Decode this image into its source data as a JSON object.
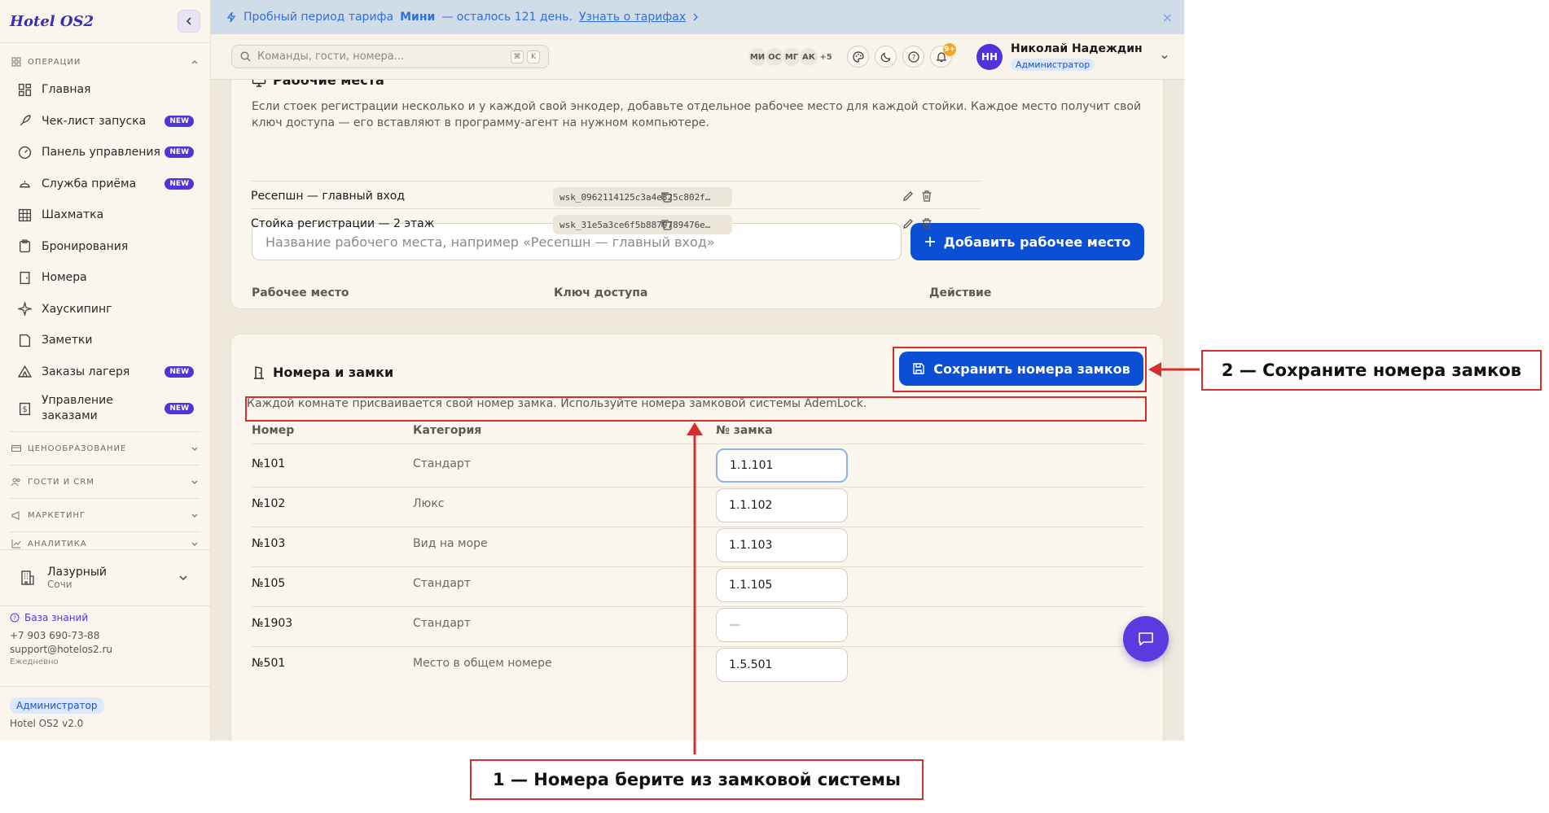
{
  "app": {
    "logo": "Hotel OS2"
  },
  "sidebar": {
    "sections": {
      "operations": "ОПЕРАЦИИ",
      "pricing": "ЦЕНООБРАЗОВАНИЕ",
      "guests": "ГОСТИ И CRM",
      "marketing": "МАРКЕТИНГ",
      "analytics": "АНАЛИТИКА"
    },
    "items": [
      {
        "label": "Главная",
        "badge": ""
      },
      {
        "label": "Чек-лист запуска",
        "badge": "NEW"
      },
      {
        "label": "Панель управления",
        "badge": "NEW"
      },
      {
        "label": "Служба приёма",
        "badge": "NEW"
      },
      {
        "label": "Шахматка",
        "badge": ""
      },
      {
        "label": "Бронирования",
        "badge": ""
      },
      {
        "label": "Номера",
        "badge": ""
      },
      {
        "label": "Хаускипинг",
        "badge": ""
      },
      {
        "label": "Заметки",
        "badge": ""
      },
      {
        "label": "Заказы лагеря",
        "badge": "NEW"
      },
      {
        "label": "Управление заказами",
        "badge": "NEW"
      }
    ],
    "hotel": {
      "name": "Лазурный",
      "city": "Сочи"
    },
    "knowledge_base": "База знаний",
    "phone": "+7 903 690-73-88",
    "email": "support@hotelos2.ru",
    "hours": "Ежедневно",
    "role": "Администратор",
    "version": "Hotel OS2 v2.0"
  },
  "banner": {
    "prefix": "Пробный период тарифа",
    "plan": "Мини",
    "suffix": "— осталось 121 день.",
    "link": "Узнать о тарифах",
    "close": "×"
  },
  "topbar": {
    "search_placeholder": "Команды, гости, номера...",
    "kbd": [
      "⌘",
      "K"
    ],
    "avatars": [
      "МИ",
      "ОС",
      "МГ",
      "АК"
    ],
    "more_avatars": "+5",
    "notif_count": "9+",
    "user": {
      "initials": "НН",
      "name": "Николай Надеждин",
      "role": "Администратор"
    }
  },
  "workplaces": {
    "title": "Рабочие места",
    "description": "Если стоек регистрации несколько и у каждой свой энкодер, добавьте отдельное рабочее место для каждой стойки. Каждое место получит свой ключ доступа — его вставляют в программу-агент на нужном компьютере.",
    "input_placeholder": "Название рабочего места, например «Ресепшн — главный вход»",
    "add_button": "Добавить рабочее место",
    "columns": {
      "place": "Рабочее место",
      "key": "Ключ доступа",
      "action": "Действие"
    },
    "rows": [
      {
        "name": "Ресепшн — главный вход",
        "key": "wsk_0962114125c3a4e325c802f…"
      },
      {
        "name": "Стойка регистрации — 2 этаж",
        "key": "wsk_31e5a3ce6f5b8879789476e…"
      }
    ]
  },
  "locks": {
    "title": "Номера и замки",
    "save_button": "Сохранить номера замков",
    "description": "Каждой комнате присваивается свой номер замка. Используйте номера замковой системы AdemLock.",
    "columns": {
      "room": "Номер",
      "category": "Категория",
      "lock": "№ замка"
    },
    "rows": [
      {
        "room": "№101",
        "category": "Стандарт",
        "lock": "1.1.101"
      },
      {
        "room": "№102",
        "category": "Люкс",
        "lock": "1.1.102"
      },
      {
        "room": "№103",
        "category": "Вид на море",
        "lock": "1.1.103"
      },
      {
        "room": "№105",
        "category": "Стандарт",
        "lock": "1.1.105"
      },
      {
        "room": "№1903",
        "category": "Стандарт",
        "lock": "",
        "placeholder": "—"
      },
      {
        "room": "№501",
        "category": "Место в общем номере",
        "lock": "1.5.501"
      }
    ]
  },
  "annotations": {
    "step1": "1 — Номера берите из замковой системы",
    "step2": "2 — Сохраните номера замков"
  },
  "colors": {
    "accent": "#4f35d9",
    "primary_button": "#0a4fd6",
    "annotation": "#d32f2f",
    "banner_bg": "#d0dce7"
  }
}
